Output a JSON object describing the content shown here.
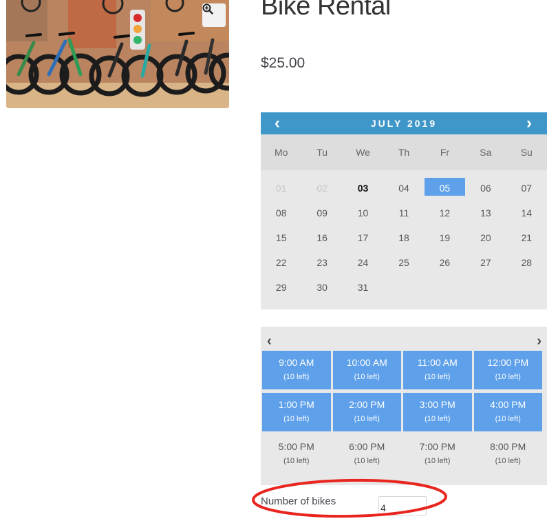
{
  "product": {
    "title": "Bike Rental",
    "price": "$25.00"
  },
  "calendar": {
    "month_label": "JULY 2019",
    "prev_icon": "‹",
    "next_icon": "›",
    "weekdays": [
      "Mo",
      "Tu",
      "We",
      "Th",
      "Fr",
      "Sa",
      "Su"
    ],
    "days": [
      "01",
      "02",
      "03",
      "04",
      "05",
      "06",
      "07",
      "08",
      "09",
      "10",
      "11",
      "12",
      "13",
      "14",
      "15",
      "16",
      "17",
      "18",
      "19",
      "20",
      "21",
      "22",
      "23",
      "24",
      "25",
      "26",
      "27",
      "28",
      "29",
      "30",
      "31"
    ],
    "disabled_days": [
      "01",
      "02"
    ],
    "today": "03",
    "selected": "05"
  },
  "slots": {
    "prev_icon": "‹",
    "next_icon": "›",
    "items": [
      {
        "time": "9:00 AM",
        "left": "(10 left)"
      },
      {
        "time": "10:00 AM",
        "left": "(10 left)"
      },
      {
        "time": "11:00 AM",
        "left": "(10 left)"
      },
      {
        "time": "12:00 PM",
        "left": "(10 left)"
      },
      {
        "time": "1:00 PM",
        "left": "(10 left)"
      },
      {
        "time": "2:00 PM",
        "left": "(10 left)"
      },
      {
        "time": "3:00 PM",
        "left": "(10 left)"
      },
      {
        "time": "4:00 PM",
        "left": "(10 left)"
      },
      {
        "time": "5:00 PM",
        "left": "(10 left)"
      },
      {
        "time": "6:00 PM",
        "left": "(10 left)"
      },
      {
        "time": "7:00 PM",
        "left": "(10 left)"
      },
      {
        "time": "8:00 PM",
        "left": "(10 left)"
      }
    ]
  },
  "quantity": {
    "label": "Number of bikes",
    "value": "4"
  },
  "icons": {
    "zoom": "zoom-in-icon"
  },
  "colors": {
    "calendar_header": "#3f96c8",
    "selected": "#5ea0ea",
    "panel": "#e8e8e8",
    "annotation": "#e8251f"
  }
}
